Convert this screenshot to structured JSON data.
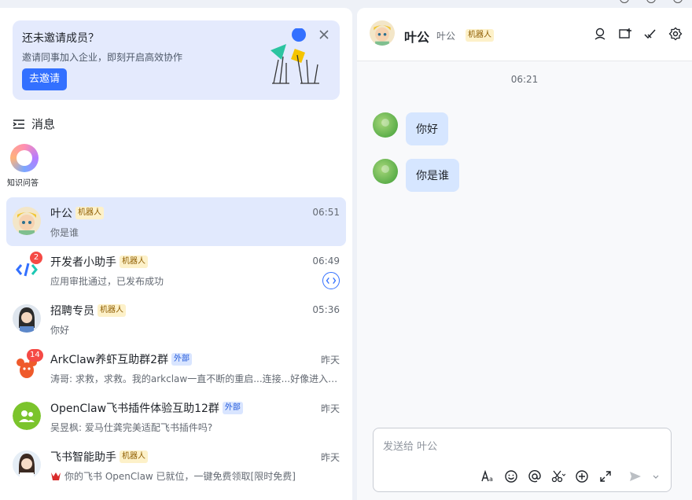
{
  "invite": {
    "title": "还未邀请成员？",
    "desc": "邀请同事加入企业，即刻开启高效协作",
    "button": "去邀请"
  },
  "nav": {
    "messages_label": "消息",
    "knowledge_label": "知识问答"
  },
  "chats": [
    {
      "name": "叶公",
      "tag": "机器人",
      "tag_type": "bot",
      "time": "06:51",
      "preview": "你是谁",
      "badge": ""
    },
    {
      "name": "开发者小助手",
      "tag": "机器人",
      "tag_type": "bot",
      "time": "06:49",
      "preview": "应用审批通过，已发布成功",
      "badge": "2"
    },
    {
      "name": "招聘专员",
      "tag": "机器人",
      "tag_type": "bot",
      "time": "05:36",
      "preview": "你好",
      "badge": ""
    },
    {
      "name": "ArkClaw养虾互助群2群",
      "tag": "外部",
      "tag_type": "ext",
      "time": "昨天",
      "preview": "涛哥: 求救，求救。我的arkclaw一直不断的重启...连接...好像进入了...",
      "badge": "14"
    },
    {
      "name": "OpenClaw飞书插件体验互助12群",
      "tag": "外部",
      "tag_type": "ext",
      "time": "昨天",
      "preview": "吴昱枫: 爱马仕龚完美适配飞书插件吗?",
      "badge": ""
    },
    {
      "name": "飞书智能助手",
      "tag": "机器人",
      "tag_type": "bot",
      "time": "昨天",
      "preview": "你的飞书 OpenClaw 已就位，一键免费领取[限时免费]",
      "badge": ""
    }
  ],
  "conversation": {
    "title": "叶公",
    "subtitle": "叶公",
    "tag": "机器人",
    "timestamp": "06:21",
    "messages": [
      "你好",
      "你是谁"
    ],
    "composer_placeholder": "发送给 叶公"
  },
  "icons": {
    "header": [
      "search-member-icon",
      "add-tab-icon",
      "checklist-icon",
      "settings-icon"
    ],
    "composer": [
      "text-format-icon",
      "emoji-icon",
      "mention-icon",
      "scissors-icon",
      "plus-icon",
      "expand-icon",
      "send-icon"
    ]
  },
  "colors": {
    "accent": "#3370ff",
    "active_row": "#e1e9fd",
    "bubble": "#d6e6ff",
    "bot_tag_bg": "#fdf1c9",
    "ext_tag_bg": "#d9e5ff",
    "badge": "#f54a45"
  }
}
